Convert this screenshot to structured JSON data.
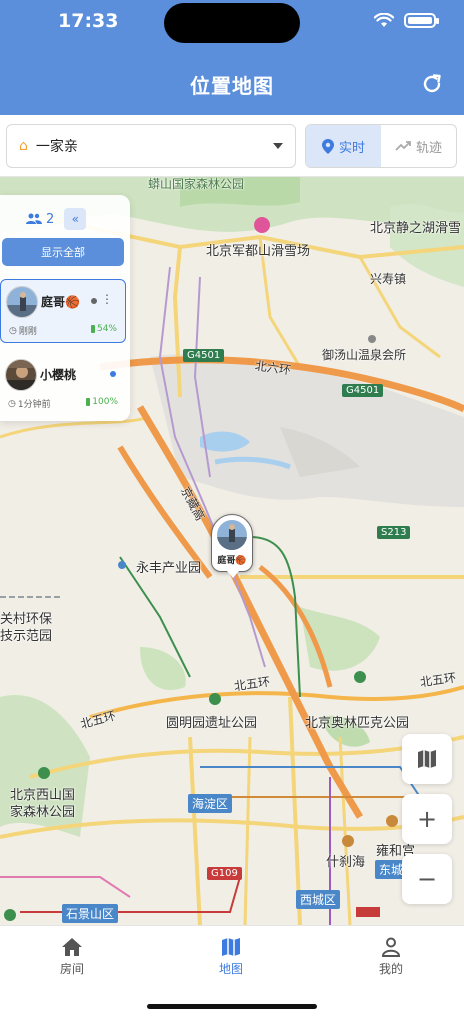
{
  "status_bar": {
    "time": "17:33"
  },
  "header": {
    "title": "位置地图"
  },
  "toolbar": {
    "group": "一家亲",
    "modes": {
      "realtime": "实时",
      "track": "轨迹"
    }
  },
  "member_panel": {
    "count": "2",
    "collapse_icon": "«",
    "show_all": "显示全部",
    "members": [
      {
        "name": "庭哥🏀",
        "time": "刚刚",
        "battery": "54%",
        "status_color": "#666666"
      },
      {
        "name": "小樱桃",
        "time": "1分钟前",
        "battery": "100%",
        "status_color": "#3d7be0"
      }
    ]
  },
  "marker": {
    "name": "庭哥🏀"
  },
  "map": {
    "labels": {
      "l1": "北京静之湖滑雪",
      "l2": "北京军都山滑雪场",
      "l3": "兴寿镇",
      "l4": "御汤山温泉会所",
      "l5": "北六环",
      "l6": "京藏高",
      "l7": "永丰产业园",
      "l8": "关村环保",
      "l9": "技示范园",
      "l10": "北五环",
      "l11": "北五环",
      "l12": "北五环",
      "l13": "圆明园遗址公园",
      "l14": "北京奥林匹克公园",
      "l15": "北京西山国",
      "l16": "家森林公园",
      "l17": "什刹海",
      "l18": "雍和宫",
      "l19": "蟒山国家森林公园"
    },
    "badges": {
      "g4501a": "G4501",
      "g4501b": "G4501",
      "s213": "S213",
      "g109": "G109"
    },
    "districts": {
      "haidian": "海淀区",
      "shijingshan": "石景山区",
      "xicheng": "西城区",
      "dongcheng": "东城"
    }
  },
  "bottom_nav": {
    "items": [
      {
        "label": "房间"
      },
      {
        "label": "地图"
      },
      {
        "label": "我的"
      }
    ]
  },
  "colors": {
    "primary": "#5b8fdb",
    "accent": "#3d7be0",
    "battery_green": "#4caf50"
  }
}
